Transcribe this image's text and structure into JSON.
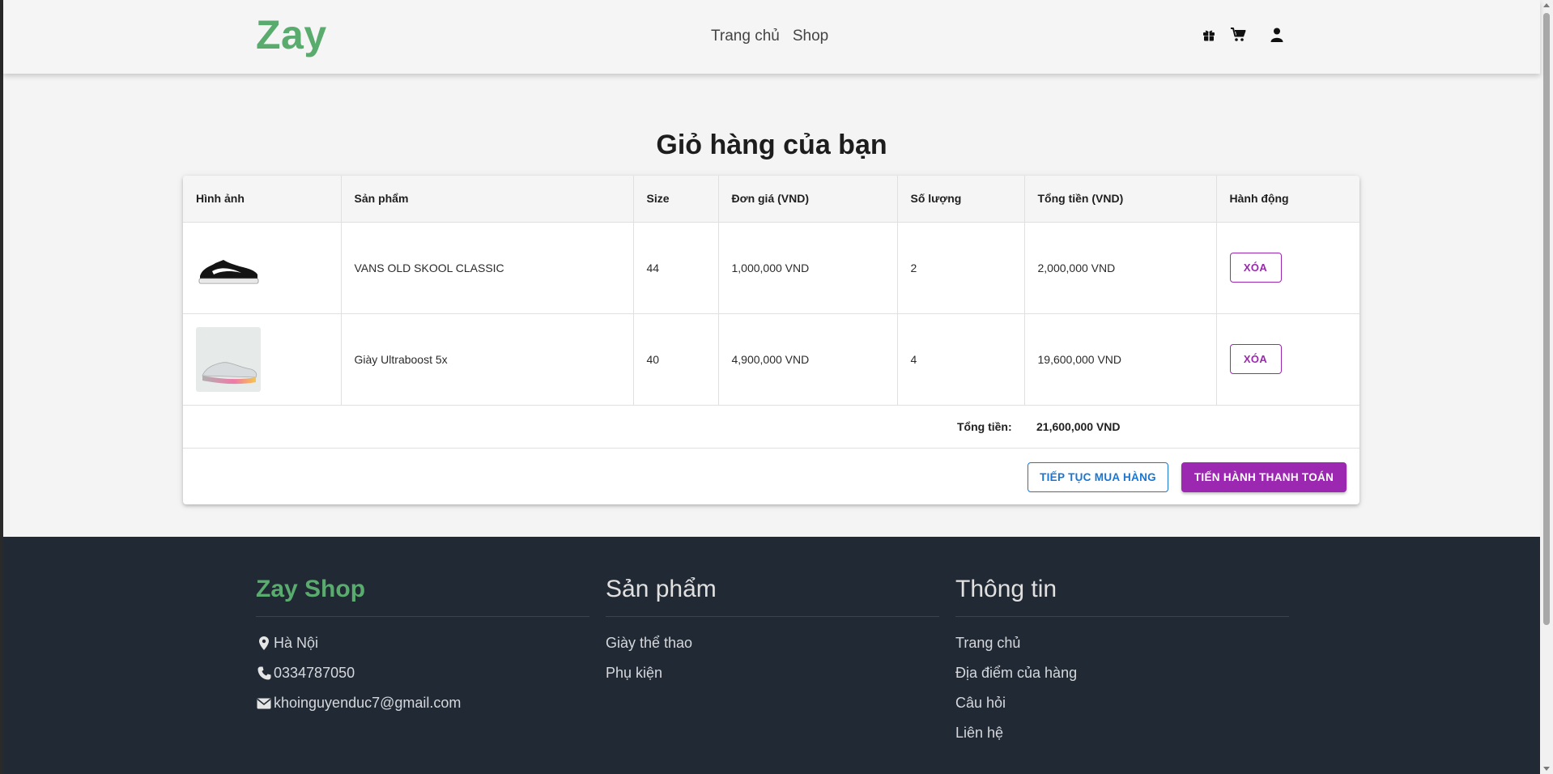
{
  "header": {
    "logo": "Zay",
    "nav": [
      {
        "label": "Trang chủ"
      },
      {
        "label": "Shop"
      }
    ],
    "icons": [
      "gift-icon",
      "cart-icon",
      "user-icon"
    ]
  },
  "cart": {
    "title": "Giỏ hàng của bạn",
    "columns": [
      "Hình ảnh",
      "Sản phẩm",
      "Size",
      "Đơn giá (VND)",
      "Số lượng",
      "Tổng tiền (VND)",
      "Hành động"
    ],
    "items": [
      {
        "image": "sneaker-black-icon",
        "product": "VANS OLD SKOOL CLASSIC",
        "size": "44",
        "unit_price": "1,000,000 VND",
        "quantity": "2",
        "total": "2,000,000 VND",
        "action": "XÓA"
      },
      {
        "image": "sneaker-gradient-icon",
        "product": "Giày Ultraboost 5x",
        "size": "40",
        "unit_price": "4,900,000 VND",
        "quantity": "4",
        "total": "19,600,000 VND",
        "action": "XÓA"
      }
    ],
    "total_label": "Tổng tiền:",
    "total_value": "21,600,000 VND",
    "continue_label": "TIẾP TỤC MUA HÀNG",
    "checkout_label": "TIẾN HÀNH THANH TOÁN"
  },
  "footer": {
    "brand": "Zay Shop",
    "contact": [
      {
        "icon": "location-icon",
        "text": "Hà Nội"
      },
      {
        "icon": "phone-icon",
        "text": "0334787050"
      },
      {
        "icon": "email-icon",
        "text": "khoinguyenduc7@gmail.com"
      }
    ],
    "products_title": "Sản phẩm",
    "products": [
      "Giày thể thao",
      "Phụ kiện"
    ],
    "info_title": "Thông tin",
    "info": [
      "Trang chủ",
      "Địa điểm của hàng",
      "Câu hỏi",
      "Liên hệ"
    ]
  },
  "colors": {
    "brand_green": "#59ab6e",
    "accent_purple": "#9c27b0",
    "accent_blue": "#1976d2",
    "footer_bg": "#212934"
  }
}
